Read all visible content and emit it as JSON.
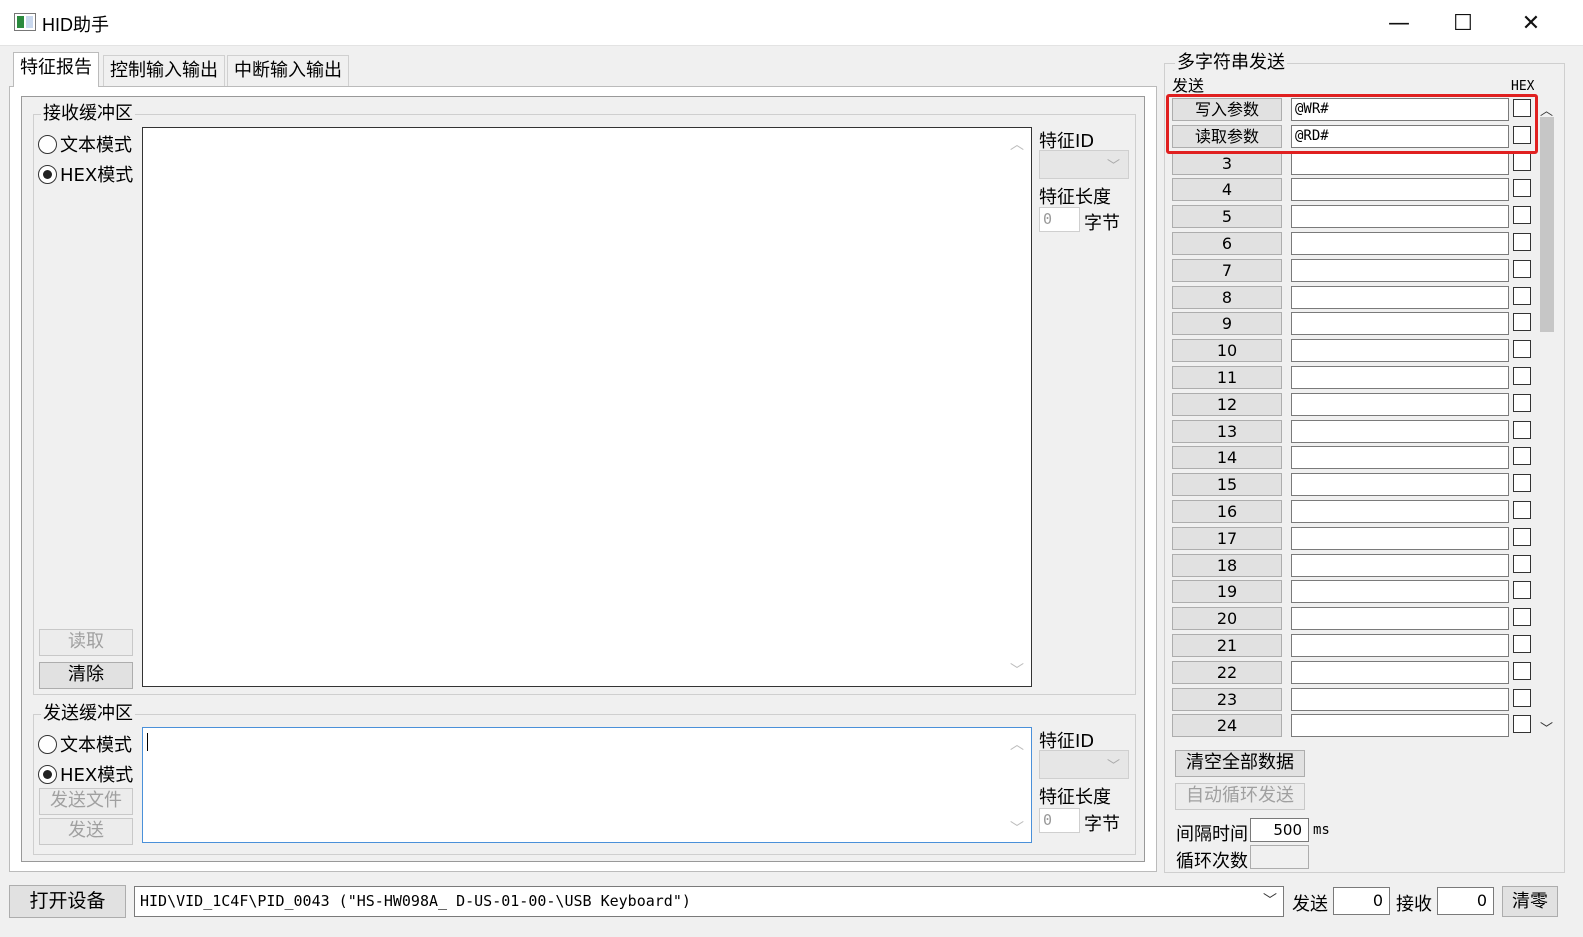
{
  "window": {
    "title": "HID助手",
    "minimize": "—",
    "maximize": "☐",
    "close": "✕"
  },
  "tabs": [
    "特征报告",
    "控制输入输出",
    "中断输入输出"
  ],
  "receive": {
    "group_title": "接收缓冲区",
    "mode_text": "文本模式",
    "mode_hex": "HEX模式",
    "read_button": "读取",
    "clear_button": "清除",
    "feature_id_label": "特征ID",
    "feature_len_label": "特征长度",
    "feature_len_value": "0",
    "bytes_label": "字节"
  },
  "send": {
    "group_title": "发送缓冲区",
    "mode_text": "文本模式",
    "mode_hex": "HEX模式",
    "send_file_button": "发送文件",
    "send_button": "发送",
    "feature_id_label": "特征ID",
    "feature_len_label": "特征长度",
    "feature_len_value": "0",
    "bytes_label": "字节"
  },
  "multi": {
    "group_title": "多字符串发送",
    "col_send": "发送",
    "col_hex": "HEX",
    "rows": [
      {
        "label": "写入参数",
        "value": "@WR#"
      },
      {
        "label": "读取参数",
        "value": "@RD#"
      },
      {
        "label": "3",
        "value": ""
      },
      {
        "label": "4",
        "value": ""
      },
      {
        "label": "5",
        "value": ""
      },
      {
        "label": "6",
        "value": ""
      },
      {
        "label": "7",
        "value": ""
      },
      {
        "label": "8",
        "value": ""
      },
      {
        "label": "9",
        "value": ""
      },
      {
        "label": "10",
        "value": ""
      },
      {
        "label": "11",
        "value": ""
      },
      {
        "label": "12",
        "value": ""
      },
      {
        "label": "13",
        "value": ""
      },
      {
        "label": "14",
        "value": ""
      },
      {
        "label": "15",
        "value": ""
      },
      {
        "label": "16",
        "value": ""
      },
      {
        "label": "17",
        "value": ""
      },
      {
        "label": "18",
        "value": ""
      },
      {
        "label": "19",
        "value": ""
      },
      {
        "label": "20",
        "value": ""
      },
      {
        "label": "21",
        "value": ""
      },
      {
        "label": "22",
        "value": ""
      },
      {
        "label": "23",
        "value": ""
      },
      {
        "label": "24",
        "value": ""
      }
    ],
    "clear_all_button": "清空全部数据",
    "auto_loop_button": "自动循环发送",
    "interval_label": "间隔时间",
    "interval_value": "500",
    "interval_unit": "ms",
    "loop_count_label": "循环次数",
    "loop_count_value": ""
  },
  "bottom": {
    "open_device_button": "打开设备",
    "device_path": "HID\\VID_1C4F\\PID_0043 (\"HS-HW098A_ D-US-01-00-\\USB Keyboard\")",
    "send_label": "发送",
    "send_count": "0",
    "recv_label": "接收",
    "recv_count": "0",
    "clear_zero_button": "清零"
  },
  "colors": {
    "highlight": "#e02020",
    "focus_border": "#4a90d9"
  }
}
